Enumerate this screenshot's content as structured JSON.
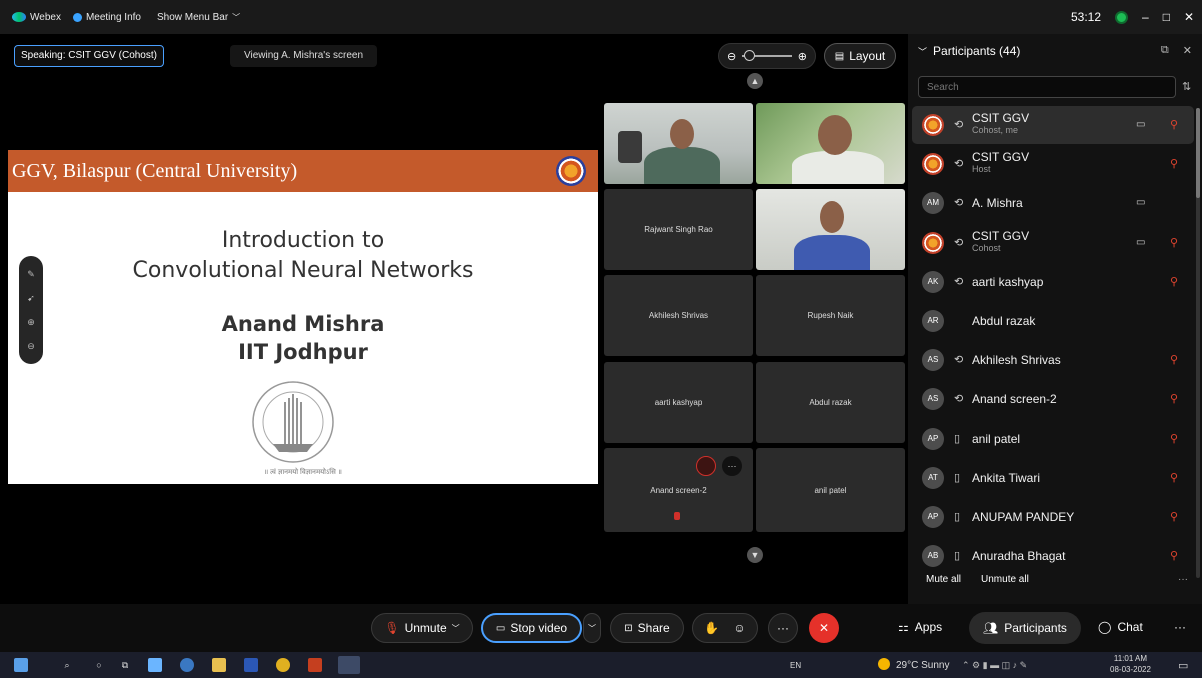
{
  "titlebar": {
    "app_name": "Webex",
    "meeting_info": "Meeting Info",
    "show_menu_bar": "Show Menu Bar",
    "chevron": "﹀",
    "timer": "53:12",
    "minimize": "–",
    "maximize": "□",
    "close": "✕"
  },
  "stage": {
    "speaking": "Speaking: CSIT GGV (Cohost)",
    "viewing": "Viewing A. Mishra's screen",
    "layout_label": "Layout",
    "zoom_out": "⊖",
    "zoom_in": "⊕"
  },
  "slide": {
    "banner": "GGV, Bilaspur (Central University)",
    "title_line1": "Introduction to",
    "title_line2": "Convolutional Neural Networks",
    "author": "Anand Mishra",
    "affiliation": "IIT Jodhpur",
    "emblem_caption": "॥ त्वं ज्ञानमयो विज्ञानमयोऽसि ॥"
  },
  "tiles": [
    {
      "name": "Rajwant Singh Rao"
    },
    {
      "name": "Akhilesh Shrivas"
    },
    {
      "name": "Rupesh Naik"
    },
    {
      "name": "aarti kashyap"
    },
    {
      "name": "Abdul razak"
    },
    {
      "name": "Anand screen-2"
    },
    {
      "name": "anil patel"
    }
  ],
  "tile_menu": "···",
  "panel": {
    "title": "Participants (44)",
    "search_placeholder": "Search",
    "mute_all": "Mute all",
    "unmute_all": "Unmute all",
    "more": "···",
    "participants": [
      {
        "initials": "",
        "name": "CSIT GGV",
        "role": "Cohost, me",
        "status": "⟲",
        "cam": "▭",
        "muted": "⚲"
      },
      {
        "initials": "",
        "name": "CSIT GGV",
        "role": "Host",
        "status": "⟲",
        "cam": "",
        "muted": "⚲"
      },
      {
        "initials": "AM",
        "name": "A. Mishra",
        "role": "",
        "status": "⟲",
        "cam": "▭",
        "muted": ""
      },
      {
        "initials": "",
        "name": "CSIT GGV",
        "role": "Cohost",
        "status": "⟲",
        "cam": "▭",
        "muted": "⚲"
      },
      {
        "initials": "AK",
        "name": "aarti kashyap",
        "role": "",
        "status": "⟲",
        "cam": "",
        "muted": "⚲"
      },
      {
        "initials": "AR",
        "name": "Abdul razak",
        "role": "",
        "status": "",
        "cam": "",
        "muted": ""
      },
      {
        "initials": "AS",
        "name": "Akhilesh Shrivas",
        "role": "",
        "status": "⟲",
        "cam": "",
        "muted": "⚲"
      },
      {
        "initials": "AS",
        "name": "Anand screen-2",
        "role": "",
        "status": "⟲",
        "cam": "",
        "muted": "⚲"
      },
      {
        "initials": "AP",
        "name": "anil patel",
        "role": "",
        "status": "▯",
        "cam": "",
        "muted": "⚲"
      },
      {
        "initials": "AT",
        "name": "Ankita Tiwari",
        "role": "",
        "status": "▯",
        "cam": "",
        "muted": "⚲"
      },
      {
        "initials": "AP",
        "name": "ANUPAM PANDEY",
        "role": "",
        "status": "▯",
        "cam": "",
        "muted": "⚲"
      },
      {
        "initials": "AB",
        "name": "Anuradha Bhagat",
        "role": "",
        "status": "▯",
        "cam": "",
        "muted": "⚲"
      }
    ]
  },
  "controls": {
    "unmute": "Unmute",
    "stop_video": "Stop video",
    "share": "Share",
    "apps": "Apps",
    "participants": "Participants",
    "chat": "Chat",
    "more": "···",
    "end": "✕"
  },
  "taskbar": {
    "lang": "EN",
    "weather": "29°C Sunny",
    "time": "11:01 AM",
    "date": "08-03-2022"
  },
  "colors": {
    "accent": "#4aa0ff",
    "end_call": "#e5312a",
    "banner": "#c45a2b",
    "mute_red": "#e0442f"
  }
}
